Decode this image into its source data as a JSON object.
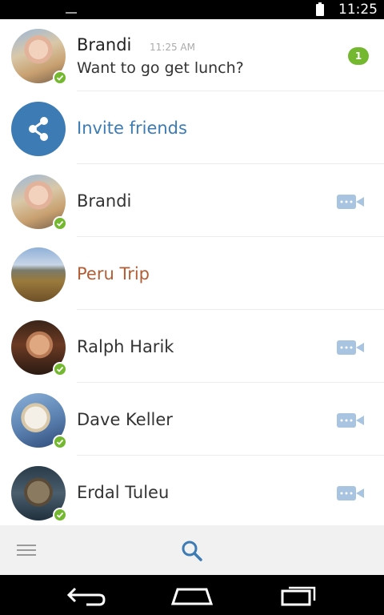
{
  "status_bar": {
    "time": "11:25"
  },
  "chats": [
    {
      "type": "conversation",
      "name": "Brandi",
      "time": "11:25 AM",
      "message": "Want to go get lunch?",
      "unread": "1",
      "online": true
    },
    {
      "type": "invite",
      "label": "Invite friends"
    },
    {
      "type": "contact",
      "name": "Brandi",
      "online": true,
      "video_call": true
    },
    {
      "type": "group",
      "name": "Peru Trip",
      "online": false,
      "video_call": false
    },
    {
      "type": "contact",
      "name": "Ralph Harik",
      "online": true,
      "video_call": true
    },
    {
      "type": "contact",
      "name": "Dave Keller",
      "online": true,
      "video_call": true
    },
    {
      "type": "contact",
      "name": "Erdal Tuleu",
      "online": true,
      "video_call": true
    }
  ],
  "colors": {
    "accent": "#3c7bb3",
    "online": "#74b830",
    "unread_badge": "#74b830",
    "group_name": "#b25d34",
    "video_icon": "#a8c4e0"
  },
  "icons": {
    "menu": "hamburger-menu-icon",
    "search": "search-icon",
    "share": "share-icon",
    "video": "video-camera-icon",
    "back": "back-icon",
    "home": "home-icon",
    "recents": "recent-apps-icon"
  }
}
